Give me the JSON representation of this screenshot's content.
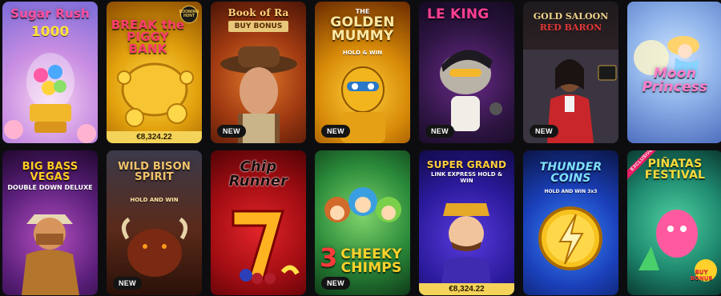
{
  "games": [
    {
      "title": "Sugar Rush",
      "subtitle": "1000",
      "badge": "",
      "jackpot": ""
    },
    {
      "title": "BREAK the PIGGY BANK",
      "subtitle": "",
      "badge": "",
      "jackpot": "€8,324.22",
      "provider_logo": "BOOMING HUNT"
    },
    {
      "title": "Book of Ra",
      "subtitle": "BUY BONUS",
      "badge": "NEW",
      "jackpot": ""
    },
    {
      "title": "GOLDEN MUMMY",
      "subtitle": "HOLD & WIN",
      "badge": "NEW",
      "jackpot": "",
      "prefix": "THE"
    },
    {
      "title": "LE KING",
      "subtitle": "",
      "badge": "NEW",
      "jackpot": ""
    },
    {
      "title": "GOLD SALOON",
      "subtitle": "RED BARON",
      "badge": "NEW",
      "jackpot": ""
    },
    {
      "title": "Moon Princess",
      "subtitle": "",
      "badge": "",
      "jackpot": ""
    },
    {
      "title": "BIG BASS VEGAS",
      "subtitle": "DOUBLE DOWN DELUXE",
      "badge": "",
      "jackpot": ""
    },
    {
      "title": "WILD BISON SPIRIT",
      "subtitle": "HOLD AND WIN",
      "badge": "NEW",
      "jackpot": ""
    },
    {
      "title": "Chip Runner",
      "subtitle": "",
      "badge": "",
      "jackpot": ""
    },
    {
      "title": "CHEEKY CHIMPS",
      "subtitle": "",
      "badge": "NEW",
      "jackpot": "",
      "prefix": "3"
    },
    {
      "title": "SUPER GRAND",
      "subtitle": "LINK EXPRESS HOLD & WIN",
      "badge": "",
      "jackpot": "€8,324.22"
    },
    {
      "title": "THUNDER COINS",
      "subtitle": "HOLD AND WIN 3x3",
      "badge": "",
      "jackpot": ""
    },
    {
      "title": "PIÑATAS FESTIVAL",
      "subtitle": "BUY BONUS",
      "badge": "",
      "jackpot": "",
      "ribbon": "EXCLUSIVE"
    }
  ]
}
